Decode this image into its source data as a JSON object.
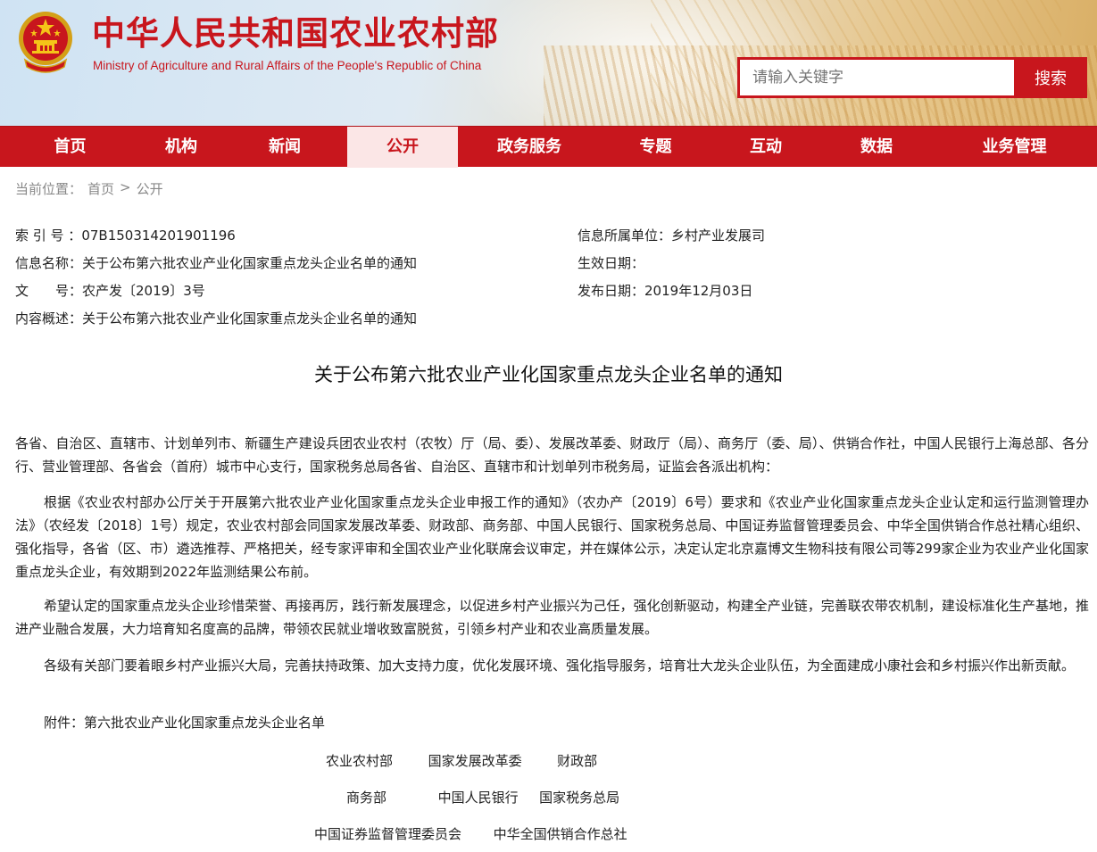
{
  "header": {
    "title": "中华人民共和国农业农村部",
    "subtitle": "Ministry of Agriculture and Rural Affairs of the People's Republic of China",
    "emblem_icon": "national-emblem-icon",
    "search": {
      "placeholder": "请输入关键字",
      "button_label": "搜索"
    },
    "colors": {
      "brand_red": "#c8161d"
    }
  },
  "nav": {
    "items": [
      {
        "label": "首页",
        "active": false
      },
      {
        "label": "机构",
        "active": false
      },
      {
        "label": "新闻",
        "active": false
      },
      {
        "label": "公开",
        "active": true
      },
      {
        "label": "政务服务",
        "active": false
      },
      {
        "label": "专题",
        "active": false
      },
      {
        "label": "互动",
        "active": false
      },
      {
        "label": "数据",
        "active": false
      },
      {
        "label": "业务管理",
        "active": false
      }
    ]
  },
  "breadcrumb": {
    "prefix": "当前位置：",
    "home": "首页",
    "sep": ">",
    "current": "公开"
  },
  "meta": {
    "index_label": "索 引 号 ：",
    "index_value": "07B150314201901196",
    "name_label": "信息名称：",
    "name_value": "关于公布第六批农业产业化国家重点龙头企业名单的通知",
    "docno_label": "文　　号：",
    "docno_value": "农产发〔2019〕3号",
    "summary_label": "内容概述：",
    "summary_value": "关于公布第六批农业产业化国家重点龙头企业名单的通知",
    "unit_label": "信息所属单位：",
    "unit_value": "乡村产业发展司",
    "effective_label": "生效日期：",
    "effective_value": "",
    "publish_label": "发布日期：",
    "publish_value": "2019年12月03日"
  },
  "document": {
    "title": "关于公布第六批农业产业化国家重点龙头企业名单的通知",
    "addressee": "各省、自治区、直辖市、计划单列市、新疆生产建设兵团农业农村（农牧）厅（局、委）、发展改革委、财政厅（局）、商务厅（委、局）、供销合作社，中国人民银行上海总部、各分行、营业管理部、各省会（首府）城市中心支行，国家税务总局各省、自治区、直辖市和计划单列市税务局，证监会各派出机构：",
    "para1": "根据《农业农村部办公厅关于开展第六批农业产业化国家重点龙头企业申报工作的通知》（农办产〔2019〕6号）要求和《农业产业化国家重点龙头企业认定和运行监测管理办法》（农经发〔2018〕1号）规定，农业农村部会同国家发展改革委、财政部、商务部、中国人民银行、国家税务总局、中国证券监督管理委员会、中华全国供销合作总社精心组织、强化指导，各省（区、市）遴选推荐、严格把关，经专家评审和全国农业产业化联席会议审定，并在媒体公示，决定认定北京嘉博文生物科技有限公司等299家企业为农业产业化国家重点龙头企业，有效期到2022年监测结果公布前。",
    "para2": "希望认定的国家重点龙头企业珍惜荣誉、再接再厉，践行新发展理念，以促进乡村产业振兴为己任，强化创新驱动，构建全产业链，完善联农带农机制，建设标准化生产基地，推进产业融合发展，大力培育知名度高的品牌，带领农民就业增收致富脱贫，引领乡村产业和农业高质量发展。",
    "para3": "各级有关部门要着眼乡村产业振兴大局，完善扶持政策、加大支持力度，优化发展环境、强化指导服务，培育壮大龙头企业队伍，为全面建成小康社会和乡村振兴作出新贡献。",
    "attachment": "附件：第六批农业产业化国家重点龙头企业名单",
    "signatories": {
      "row1": [
        "农业农村部",
        "国家发展改革委",
        "财政部"
      ],
      "row2": [
        "商务部",
        "中国人民银行",
        "国家税务总局"
      ],
      "row3": [
        "中国证券监督管理委员会",
        "中华全国供销合作总社"
      ]
    }
  }
}
